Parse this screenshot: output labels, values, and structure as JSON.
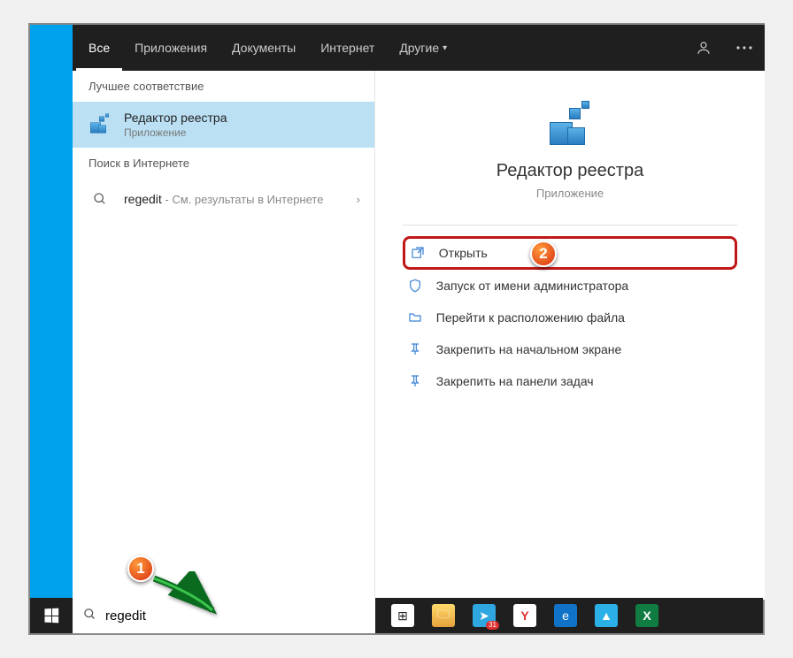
{
  "tabs": {
    "all": "Все",
    "apps": "Приложения",
    "documents": "Документы",
    "internet": "Интернет",
    "more": "Другие"
  },
  "sections": {
    "best_match": "Лучшее соответствие",
    "web": "Поиск в Интернете"
  },
  "best_match": {
    "title": "Редактор реестра",
    "subtitle": "Приложение"
  },
  "web_result": {
    "query": "regedit",
    "suffix": " - См. результаты в Интернете"
  },
  "preview": {
    "title": "Редактор реестра",
    "subtitle": "Приложение"
  },
  "actions": {
    "open": "Открыть",
    "run_admin": "Запуск от имени администратора",
    "open_location": "Перейти к расположению файла",
    "pin_start": "Закрепить на начальном экране",
    "pin_taskbar": "Закрепить на панели задач"
  },
  "search": {
    "value": "regedit"
  },
  "steps": {
    "s1": "1",
    "s2": "2"
  },
  "taskbar_badge": "31"
}
